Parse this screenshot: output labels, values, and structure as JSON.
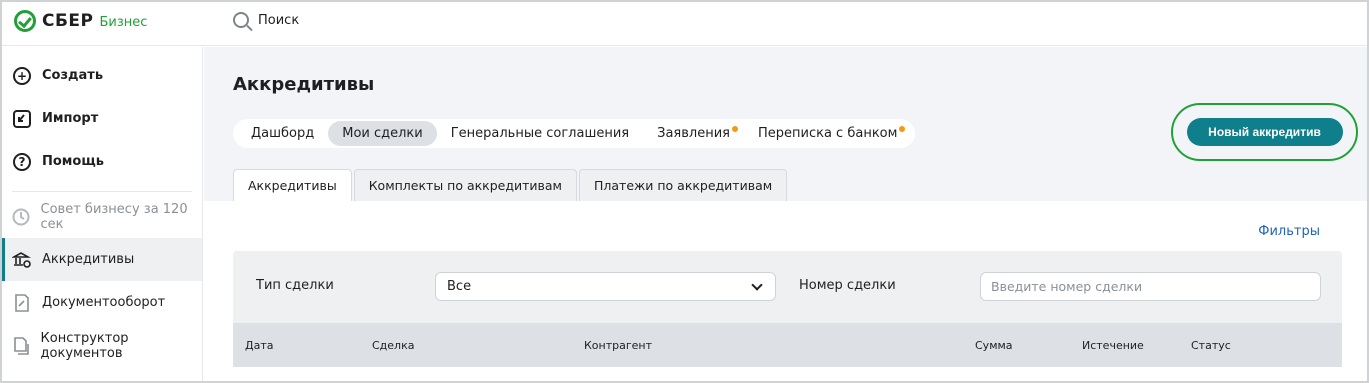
{
  "brand": {
    "name": "СБЕР",
    "sub": "Бизнес"
  },
  "search": {
    "label": "Поиск"
  },
  "sidebar": {
    "items": [
      {
        "label": "Создать"
      },
      {
        "label": "Импорт"
      },
      {
        "label": "Помощь"
      },
      {
        "label": "Совет бизнесу за 120 сек"
      },
      {
        "label": "Аккредитивы"
      },
      {
        "label": "Документооборот"
      },
      {
        "label": "Конструктор документов"
      }
    ]
  },
  "page": {
    "title": "Аккредитивы"
  },
  "tabs": [
    {
      "label": "Дашборд"
    },
    {
      "label": "Мои сделки"
    },
    {
      "label": "Генеральные соглашения"
    },
    {
      "label": "Заявления"
    },
    {
      "label": "Переписка с банком"
    }
  ],
  "new_button": {
    "label": "Новый аккредитив"
  },
  "subtabs": [
    {
      "label": "Аккредитивы"
    },
    {
      "label": "Комплекты по аккредитивам"
    },
    {
      "label": "Платежи по аккредитивам"
    }
  ],
  "filters": {
    "link": "Фильтры",
    "deal_type_label": "Тип сделки",
    "deal_type_value": "Все",
    "deal_number_label": "Номер сделки",
    "deal_number_placeholder": "Введите номер сделки"
  },
  "table": {
    "columns": [
      "Дата",
      "Сделка",
      "Контрагент",
      "Сумма",
      "Истечение",
      "Статус"
    ]
  },
  "colors": {
    "accent": "#107f8c",
    "brand": "#21a038",
    "dot": "#f29a11",
    "link": "#2163b6"
  }
}
